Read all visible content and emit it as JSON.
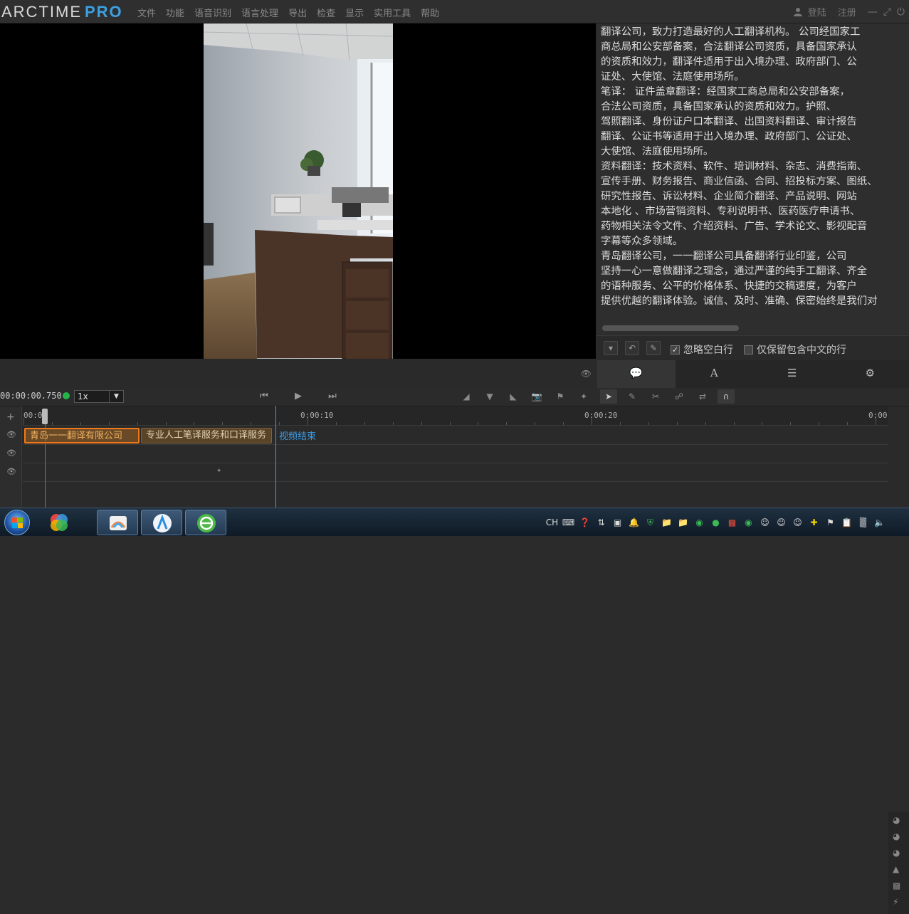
{
  "app": {
    "logo_main": "ARCTIME",
    "logo_pro": "PRO",
    "menu": [
      "文件",
      "功能",
      "语音识别",
      "语言处理",
      "导出",
      "检查",
      "显示",
      "实用工具",
      "帮助"
    ],
    "login": "登陆",
    "register": "注册"
  },
  "text_panel": {
    "lines": [
      "翻译公司，致力打造最好的人工翻译机构。 公司经国家工",
      "商总局和公安部备案，合法翻译公司资质，具备国家承认",
      "的资质和效力，翻译件适用于出入境办理、政府部门、公",
      "证处、大使馆、法庭使用场所。",
      "笔译： 证件盖章翻译：经国家工商总局和公安部备案，",
      "合法公司资质，具备国家承认的资质和效力。护照、",
      "驾照翻译、身份证户口本翻译、出国资料翻译、审计报告",
      "翻译、公证书等适用于出入境办理、政府部门、公证处、",
      "大使馆、法庭使用场所。",
      "资料翻译：技术资料、软件、培训材料、杂志、消费指南、",
      "宣传手册、财务报告、商业信函、合同、招投标方案、图纸、",
      "研究性报告、诉讼材料、企业简介翻译、产品说明、网站",
      "本地化 、市场营销资料、专利说明书、医药医疗申请书、",
      "药物相关法令文件、介绍资料、广告、学术论文、影视配音",
      "字幕等众多领域。",
      "        青岛翻译公司，一一翻译公司具备翻译行业印鉴，公司",
      "坚持一心一意做翻译之理念，通过严谨的纯手工翻译、齐全",
      "的语种服务、公平的价格体系、快捷的交稿速度，为客户",
      "提供优越的翻译体验。诚信、及时、准确、保密始终是我们对"
    ],
    "ignore_empty_label": "忽略空白行",
    "ignore_empty_checked": true,
    "keep_chinese_label": "仅保留包含中文的行",
    "keep_chinese_checked": false
  },
  "tabs": [
    "subtitle-tab",
    "font-tab",
    "list-tab",
    "settings-tab"
  ],
  "transport": {
    "timecode": "00:00:00.750",
    "speed": "1x"
  },
  "timeline": {
    "ruler": [
      "00:00",
      "0:00:10",
      "0:00:20",
      "0:00"
    ],
    "clip1": "青岛一一翻译有限公司",
    "clip2": "专业人工笔译服务和口译服务",
    "end_label": "视频结束"
  },
  "taskbar": {
    "tray_lang": "CH"
  },
  "colors": {
    "accent_blue": "#3ba1e3",
    "clip_selected_border": "#f07a1a",
    "playhead": "#e74c2c",
    "status_dot": "#26b34a"
  }
}
